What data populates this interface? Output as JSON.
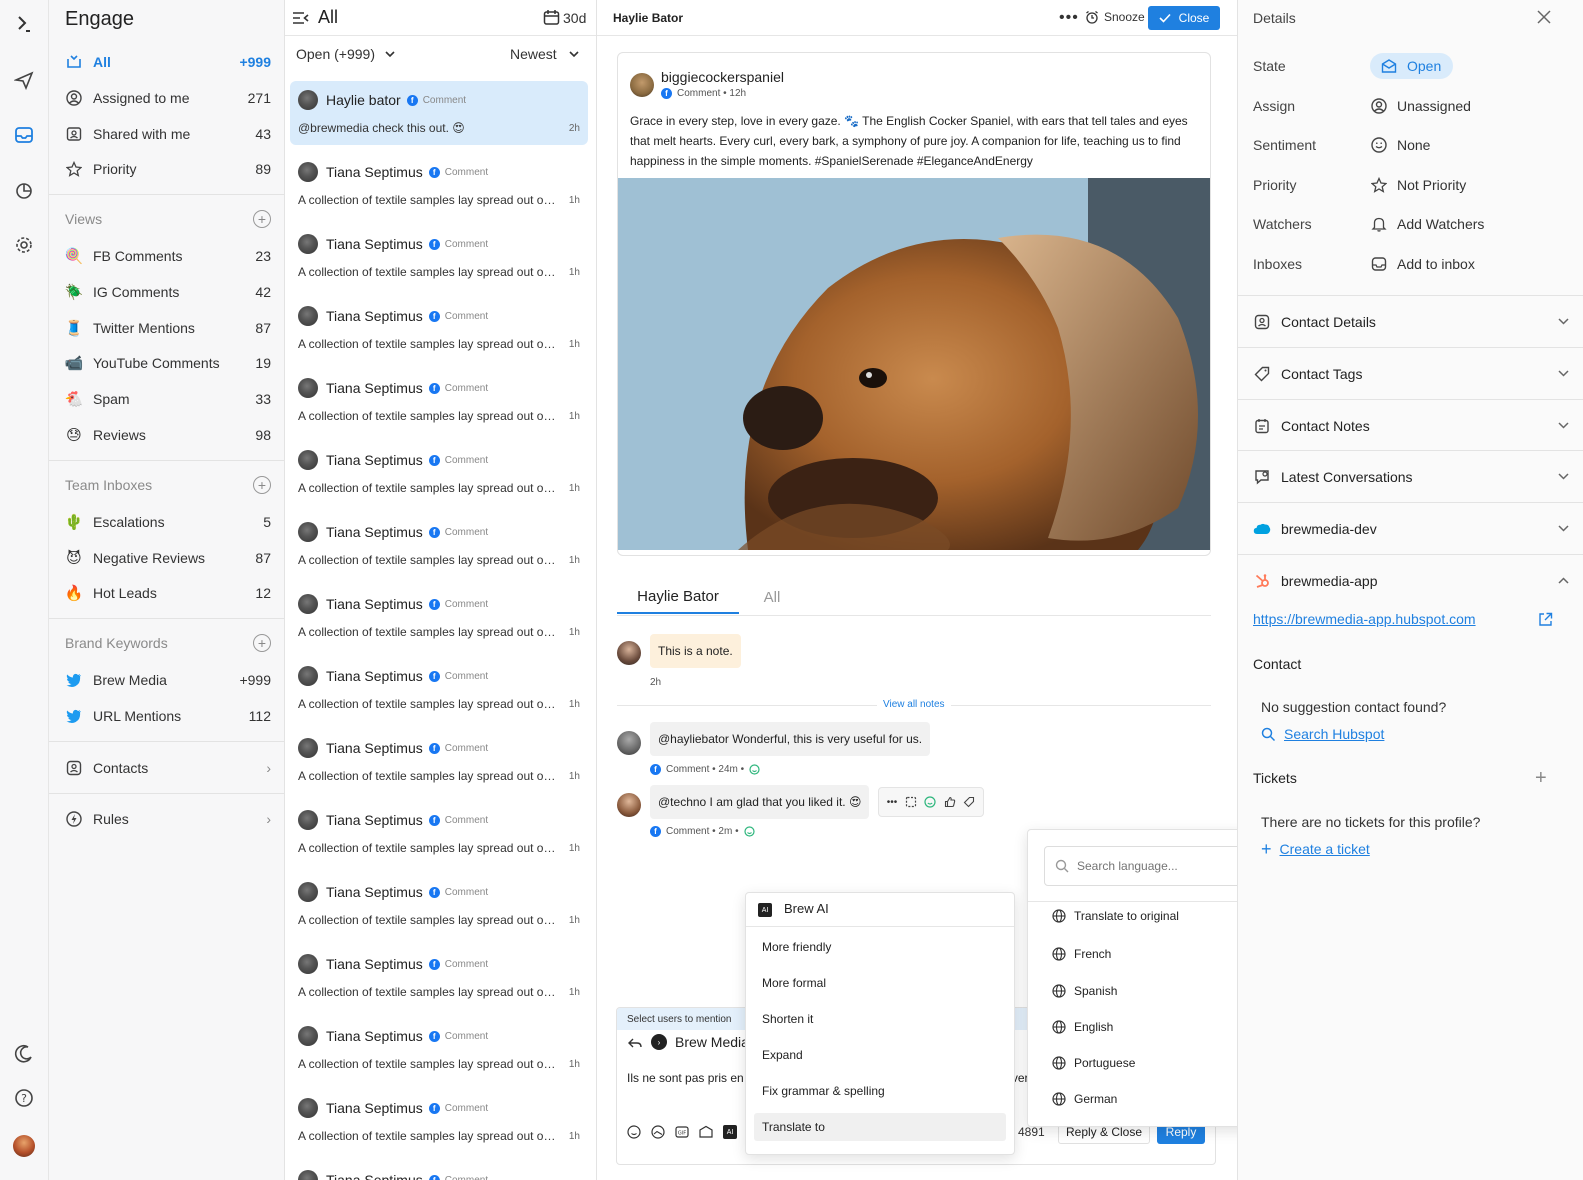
{
  "app": {
    "name": "Engage"
  },
  "sidebar": {
    "main_items": [
      {
        "label": "All",
        "count": "+999",
        "icon": "all-inbox-icon"
      },
      {
        "label": "Assigned to me",
        "count": "271",
        "icon": "user-circle-icon"
      },
      {
        "label": "Shared with me",
        "count": "43",
        "icon": "shared-icon"
      },
      {
        "label": "Priority",
        "count": "89",
        "icon": "star-icon"
      }
    ],
    "views_title": "Views",
    "views": [
      {
        "label": "FB Comments",
        "count": "23",
        "emoji": "🍭"
      },
      {
        "label": "IG Comments",
        "count": "42",
        "emoji": "🪲"
      },
      {
        "label": "Twitter Mentions",
        "count": "87",
        "emoji": "🧵"
      },
      {
        "label": "YouTube Comments",
        "count": "19",
        "emoji": "📹"
      },
      {
        "label": "Spam",
        "count": "33",
        "emoji": "🐔"
      },
      {
        "label": "Reviews",
        "count": "98",
        "emoji": "😓"
      }
    ],
    "team_title": "Team Inboxes",
    "team": [
      {
        "label": "Escalations",
        "count": "5",
        "emoji": "🌵"
      },
      {
        "label": "Negative Reviews",
        "count": "87",
        "emoji": "😈"
      },
      {
        "label": "Hot Leads",
        "count": "12",
        "emoji": "🔥"
      }
    ],
    "brand_title": "Brand Keywords",
    "brand": [
      {
        "label": "Brew Media",
        "count": "+999"
      },
      {
        "label": "URL Mentions",
        "count": "112"
      }
    ],
    "contacts_label": "Contacts",
    "rules_label": "Rules"
  },
  "list": {
    "title": "All",
    "range": "30d",
    "filter": "Open (+999)",
    "sort": "Newest",
    "items": [
      {
        "name": "Haylie bator",
        "type": "Comment",
        "preview": "@brewmedia check this out. 😍",
        "time": "2h"
      },
      {
        "name": "Tiana Septimus",
        "type": "Comment",
        "preview": "A collection of textile samples lay spread out on the table",
        "time": "1h"
      },
      {
        "name": "Tiana Septimus",
        "type": "Comment",
        "preview": "A collection of textile samples lay spread out on the table",
        "time": "1h"
      },
      {
        "name": "Tiana Septimus",
        "type": "Comment",
        "preview": "A collection of textile samples lay spread out on the table",
        "time": "1h"
      },
      {
        "name": "Tiana Septimus",
        "type": "Comment",
        "preview": "A collection of textile samples lay spread out on the table",
        "time": "1h"
      },
      {
        "name": "Tiana Septimus",
        "type": "Comment",
        "preview": "A collection of textile samples lay spread out on the table",
        "time": "1h"
      },
      {
        "name": "Tiana Septimus",
        "type": "Comment",
        "preview": "A collection of textile samples lay spread out on the table",
        "time": "1h"
      },
      {
        "name": "Tiana Septimus",
        "type": "Comment",
        "preview": "A collection of textile samples lay spread out on the table",
        "time": "1h"
      },
      {
        "name": "Tiana Septimus",
        "type": "Comment",
        "preview": "A collection of textile samples lay spread out on the table",
        "time": "1h"
      },
      {
        "name": "Tiana Septimus",
        "type": "Comment",
        "preview": "A collection of textile samples lay spread out on the table",
        "time": "1h"
      },
      {
        "name": "Tiana Septimus",
        "type": "Comment",
        "preview": "A collection of textile samples lay spread out on the table",
        "time": "1h"
      },
      {
        "name": "Tiana Septimus",
        "type": "Comment",
        "preview": "A collection of textile samples lay spread out on the table",
        "time": "1h"
      },
      {
        "name": "Tiana Septimus",
        "type": "Comment",
        "preview": "A collection of textile samples lay spread out on the table",
        "time": "1h"
      },
      {
        "name": "Tiana Septimus",
        "type": "Comment",
        "preview": "A collection of textile samples lay spread out on the table",
        "time": "1h"
      },
      {
        "name": "Tiana Septimus",
        "type": "Comment",
        "preview": "A collection of textile samples lay spread out on the table",
        "time": "1h"
      },
      {
        "name": "Tiana Septimus",
        "type": "Comment",
        "preview": "",
        "time": ""
      }
    ]
  },
  "main": {
    "title": "Haylie Bator",
    "snooze": "Snooze",
    "close": "Close",
    "post": {
      "author": "biggiecockerspaniel",
      "meta": "Comment • 12h",
      "text": "Grace in every step, love in every gaze. 🐾 The English Cocker Spaniel, with ears that tell tales and eyes that melt hearts. Every curl, every bark, a symphony of pure joy. A companion for life, teaching us to find happiness in the simple moments. #SpanielSerenade #EleganceAndEnergy"
    },
    "tabs": [
      "Haylie Bator",
      "All"
    ],
    "note": {
      "text": "This is a note.",
      "time": "2h"
    },
    "view_all_notes": "View all notes",
    "messages": [
      {
        "text": "@hayliebator Wonderful, this is very useful for us.",
        "meta": "Comment • 24m •"
      },
      {
        "text": "@techno I am glad that you liked it. 😍",
        "meta": "Comment • 2m •"
      }
    ],
    "composer": {
      "mention_hint": "Select users to mention",
      "account": "Brew Media",
      "draft": "Ils ne sont pas pris en charge pour le moment, mais ils le seront dans la version prochaine.",
      "char_count": "4891",
      "reply_close": "Reply & Close",
      "reply": "Reply"
    }
  },
  "brew_ai": {
    "title": "Brew AI",
    "items": [
      "More friendly",
      "More formal",
      "Shorten it",
      "Expand",
      "Fix grammar & spelling",
      "Translate to"
    ]
  },
  "language_menu": {
    "placeholder": "Search language...",
    "items": [
      "Translate to original",
      "French",
      "Spanish",
      "English",
      "Portuguese",
      "German"
    ]
  },
  "details": {
    "title": "Details",
    "rows": [
      {
        "key": "State",
        "value": "Open"
      },
      {
        "key": "Assign",
        "value": "Unassigned"
      },
      {
        "key": "Sentiment",
        "value": "None"
      },
      {
        "key": "Priority",
        "value": "Not Priority"
      },
      {
        "key": "Watchers",
        "value": "Add Watchers"
      },
      {
        "key": "Inboxes",
        "value": "Add to inbox"
      }
    ],
    "sections": [
      "Contact Details",
      "Contact Tags",
      "Contact Notes",
      "Latest Conversations",
      "brewmedia-dev",
      "brewmedia-app"
    ],
    "hubspot_url": "https://brewmedia-app.hubspot.com",
    "contact_label": "Contact",
    "no_contact": "No suggestion contact found?",
    "search_hubspot": "Search Hubspot",
    "tickets_label": "Tickets",
    "no_tickets": "There are no tickets for this profile?",
    "create_ticket": "Create a ticket"
  },
  "colors": {
    "accent": "#1f80e0",
    "selected_bg": "#d9ebfb",
    "note_bg": "#fdf0dc"
  }
}
